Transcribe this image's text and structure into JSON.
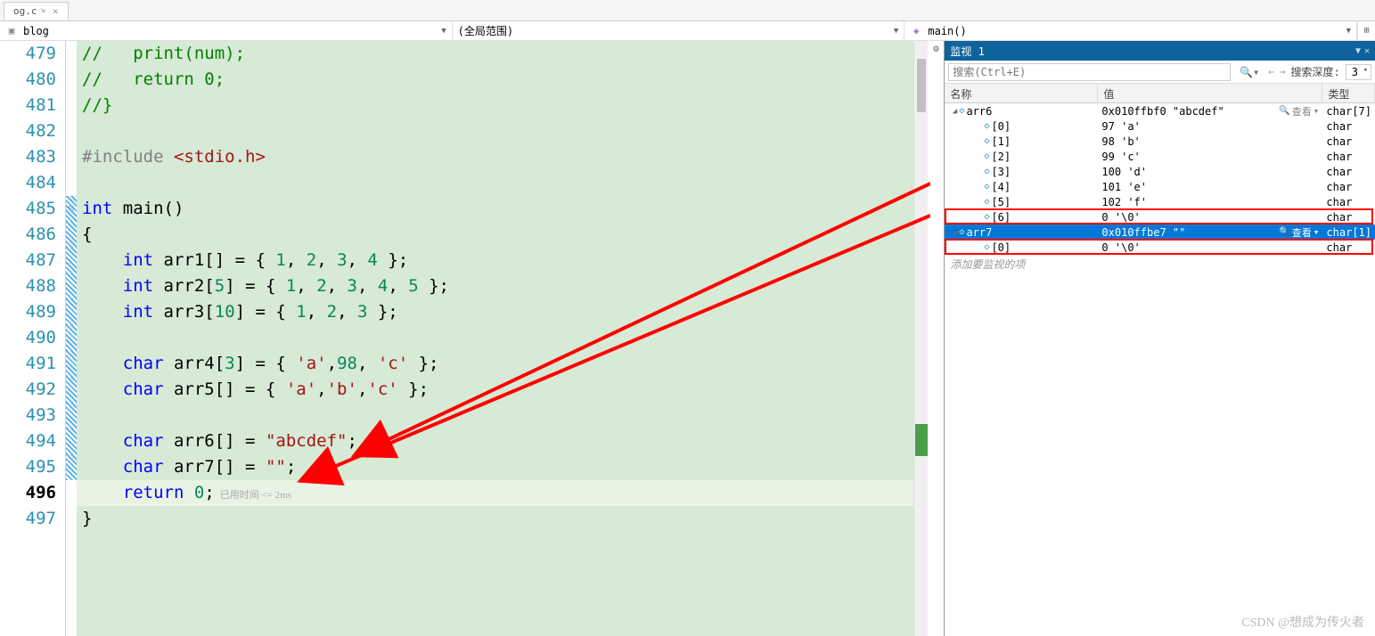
{
  "tab": {
    "name": "og.c",
    "pin": "⇲",
    "close": "✕"
  },
  "nav": {
    "scope_left": "blog",
    "scope_mid": "(全局范围)",
    "scope_right": "main()"
  },
  "gutter_start": 479,
  "code": [
    {
      "n": 479,
      "html": "<span class='c-comment'>//   print(num);</span>"
    },
    {
      "n": 480,
      "html": "<span class='c-comment'>//   return 0;</span>"
    },
    {
      "n": 481,
      "html": "<span class='c-comment'>//}</span>"
    },
    {
      "n": 482,
      "html": ""
    },
    {
      "n": 483,
      "html": "<span class='c-inc'>#include </span><span class='c-incfile'>&lt;stdio.h&gt;</span>"
    },
    {
      "n": 484,
      "html": ""
    },
    {
      "n": 485,
      "html": "<span class='c-kw'>int</span> <span class='c-text'>main()</span>"
    },
    {
      "n": 486,
      "html": "<span class='c-text'>{</span>"
    },
    {
      "n": 487,
      "html": "    <span class='c-kw'>int</span> <span class='c-text'>arr1[] = { </span><span class='c-num'>1</span><span class='c-text'>, </span><span class='c-num'>2</span><span class='c-text'>, </span><span class='c-num'>3</span><span class='c-text'>, </span><span class='c-num'>4</span><span class='c-text'> };</span>"
    },
    {
      "n": 488,
      "html": "    <span class='c-kw'>int</span> <span class='c-text'>arr2[</span><span class='c-num'>5</span><span class='c-text'>] = { </span><span class='c-num'>1</span><span class='c-text'>, </span><span class='c-num'>2</span><span class='c-text'>, </span><span class='c-num'>3</span><span class='c-text'>, </span><span class='c-num'>4</span><span class='c-text'>, </span><span class='c-num'>5</span><span class='c-text'> };</span>"
    },
    {
      "n": 489,
      "html": "    <span class='c-kw'>int</span> <span class='c-text'>arr3[</span><span class='c-num'>10</span><span class='c-text'>] = { </span><span class='c-num'>1</span><span class='c-text'>, </span><span class='c-num'>2</span><span class='c-text'>, </span><span class='c-num'>3</span><span class='c-text'> };</span>"
    },
    {
      "n": 490,
      "html": ""
    },
    {
      "n": 491,
      "html": "    <span class='c-kw'>char</span> <span class='c-text'>arr4[</span><span class='c-num'>3</span><span class='c-text'>] = { </span><span class='c-char'>'a'</span><span class='c-text'>,</span><span class='c-num'>98</span><span class='c-text'>, </span><span class='c-char'>'c'</span><span class='c-text'> };</span>"
    },
    {
      "n": 492,
      "html": "    <span class='c-kw'>char</span> <span class='c-text'>arr5[] = { </span><span class='c-char'>'a'</span><span class='c-text'>,</span><span class='c-char'>'b'</span><span class='c-text'>,</span><span class='c-char'>'c'</span><span class='c-text'> };</span>"
    },
    {
      "n": 493,
      "html": ""
    },
    {
      "n": 494,
      "html": "    <span class='c-kw'>char</span> <span class='c-text'>arr6[] = </span><span class='c-str'>\"abcdef\"</span><span class='c-text'>;</span>"
    },
    {
      "n": 495,
      "html": "    <span class='c-kw'>char</span> <span class='c-text'>arr7[] = </span><span class='c-str'>\"\"</span><span class='c-text'>;</span>"
    },
    {
      "n": 496,
      "html": "    <span class='c-kw'>return</span> <span class='c-num'>0</span><span class='c-text'>;</span><span class='elapsed'>已用时间 &lt;= 2ms</span>",
      "cur": true
    },
    {
      "n": 497,
      "html": "<span class='c-text'>}</span>"
    }
  ],
  "watch": {
    "title": "监视 1",
    "search_placeholder": "搜索(Ctrl+E)",
    "depth_label": "搜索深度:",
    "depth_value": "3",
    "columns": {
      "name": "名称",
      "value": "值",
      "type": "类型"
    },
    "view_label": "查看",
    "rows": [
      {
        "indent": 0,
        "expand": "open",
        "name": "arr6",
        "value": "0x010ffbf0 \"abcdef\"",
        "type": "char[7]",
        "viewbtn": true
      },
      {
        "indent": 1,
        "name": "[0]",
        "value": "97 'a'",
        "type": "char"
      },
      {
        "indent": 1,
        "name": "[1]",
        "value": "98 'b'",
        "type": "char"
      },
      {
        "indent": 1,
        "name": "[2]",
        "value": "99 'c'",
        "type": "char"
      },
      {
        "indent": 1,
        "name": "[3]",
        "value": "100 'd'",
        "type": "char"
      },
      {
        "indent": 1,
        "name": "[4]",
        "value": "101 'e'",
        "type": "char"
      },
      {
        "indent": 1,
        "name": "[5]",
        "value": "102 'f'",
        "type": "char"
      },
      {
        "indent": 1,
        "name": "[6]",
        "value": "0 '\\0'",
        "type": "char",
        "redbox": true
      },
      {
        "indent": 0,
        "expand": "open",
        "name": "arr7",
        "value": "0x010ffbe7 \"\"",
        "type": "char[1]",
        "selected": true,
        "viewbtn": true
      },
      {
        "indent": 1,
        "name": "[0]",
        "value": "0 '\\0'",
        "type": "char",
        "redbox": true
      }
    ],
    "add_placeholder": "添加要监视的项"
  },
  "watermark": "CSDN @想成为传火者"
}
